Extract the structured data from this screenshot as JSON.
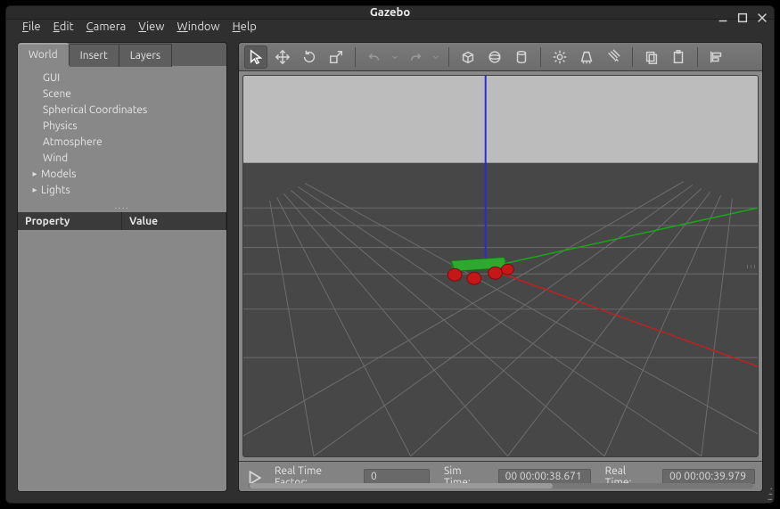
{
  "window": {
    "title": "Gazebo"
  },
  "menubar": {
    "items": [
      {
        "label": "File",
        "accel": "F"
      },
      {
        "label": "Edit",
        "accel": "E"
      },
      {
        "label": "Camera",
        "accel": "C"
      },
      {
        "label": "View",
        "accel": "V"
      },
      {
        "label": "Window",
        "accel": "W"
      },
      {
        "label": "Help",
        "accel": "H"
      }
    ]
  },
  "sidebar": {
    "tabs": [
      "World",
      "Insert",
      "Layers"
    ],
    "active_tab": 0,
    "tree": {
      "items": [
        {
          "label": "GUI",
          "expandable": false
        },
        {
          "label": "Scene",
          "expandable": false
        },
        {
          "label": "Spherical Coordinates",
          "expandable": false
        },
        {
          "label": "Physics",
          "expandable": false
        },
        {
          "label": "Atmosphere",
          "expandable": false
        },
        {
          "label": "Wind",
          "expandable": false
        },
        {
          "label": "Models",
          "expandable": true
        },
        {
          "label": "Lights",
          "expandable": true
        }
      ]
    },
    "props": {
      "col_property": "Property",
      "col_value": "Value"
    }
  },
  "toolbar": {
    "items": [
      {
        "name": "select-tool-icon",
        "active": true
      },
      {
        "name": "move-tool-icon"
      },
      {
        "name": "rotate-tool-icon"
      },
      {
        "name": "scale-tool-icon"
      },
      {
        "sep": true
      },
      {
        "name": "undo-icon",
        "disabled": true
      },
      {
        "name": "undo-menu-icon",
        "disabled": true,
        "narrow": true
      },
      {
        "name": "redo-icon",
        "disabled": true
      },
      {
        "name": "redo-menu-icon",
        "disabled": true,
        "narrow": true
      },
      {
        "sep": true
      },
      {
        "name": "box-shape-icon"
      },
      {
        "name": "sphere-shape-icon"
      },
      {
        "name": "cylinder-shape-icon"
      },
      {
        "sep": true
      },
      {
        "name": "point-light-icon"
      },
      {
        "name": "spot-light-icon"
      },
      {
        "name": "directional-light-icon"
      },
      {
        "sep": true
      },
      {
        "name": "copy-icon"
      },
      {
        "name": "paste-icon"
      },
      {
        "sep": true
      },
      {
        "name": "align-icon"
      }
    ]
  },
  "status": {
    "rtf_label": "Real Time Factor:",
    "rtf_value": "0",
    "sim_label": "Sim Time:",
    "sim_value": "00 00:00:38.671",
    "real_label": "Real Time:",
    "real_value": "00 00:00:39.979"
  },
  "scene": {
    "colors": {
      "sky": "#bcbcbc",
      "ground": "#474747",
      "grid": "#6d6d6d",
      "x_axis": "#c22020",
      "y_axis": "#1aa51a",
      "z_axis": "#2a2ae0",
      "robot_body": "#2fa82f",
      "robot_wheel": "#c41717"
    }
  }
}
